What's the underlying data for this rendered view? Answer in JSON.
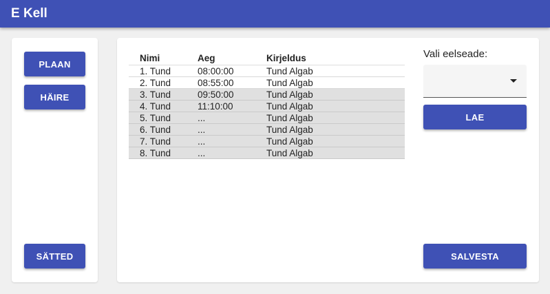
{
  "app": {
    "title": "E Kell"
  },
  "nav": {
    "plaan_label": "PLAAN",
    "haire_label": "HÄIRE",
    "satted_label": "SÄTTED"
  },
  "table": {
    "headers": [
      "Nimi",
      "Aeg",
      "Kirjeldus"
    ],
    "rows": [
      [
        "1. Tund",
        "08:00:00",
        "Tund Algab"
      ],
      [
        "2. Tund",
        "08:55:00",
        "Tund Algab"
      ],
      [
        "3. Tund",
        "09:50:00",
        "Tund Algab"
      ],
      [
        "4. Tund",
        "11:10:00",
        "Tund Algab"
      ],
      [
        "5. Tund",
        "...",
        "Tund Algab"
      ],
      [
        "6. Tund",
        "...",
        "Tund Algab"
      ],
      [
        "7. Tund",
        "...",
        "Tund Algab"
      ],
      [
        "8. Tund",
        "...",
        "Tund Algab"
      ]
    ]
  },
  "preset": {
    "label": "Vali eelseade:",
    "value": "",
    "load_label": "LAE"
  },
  "actions": {
    "save_label": "SALVESTA"
  },
  "colors": {
    "primary": "#3f51b5",
    "row_highlight": "#e0e0e0"
  }
}
